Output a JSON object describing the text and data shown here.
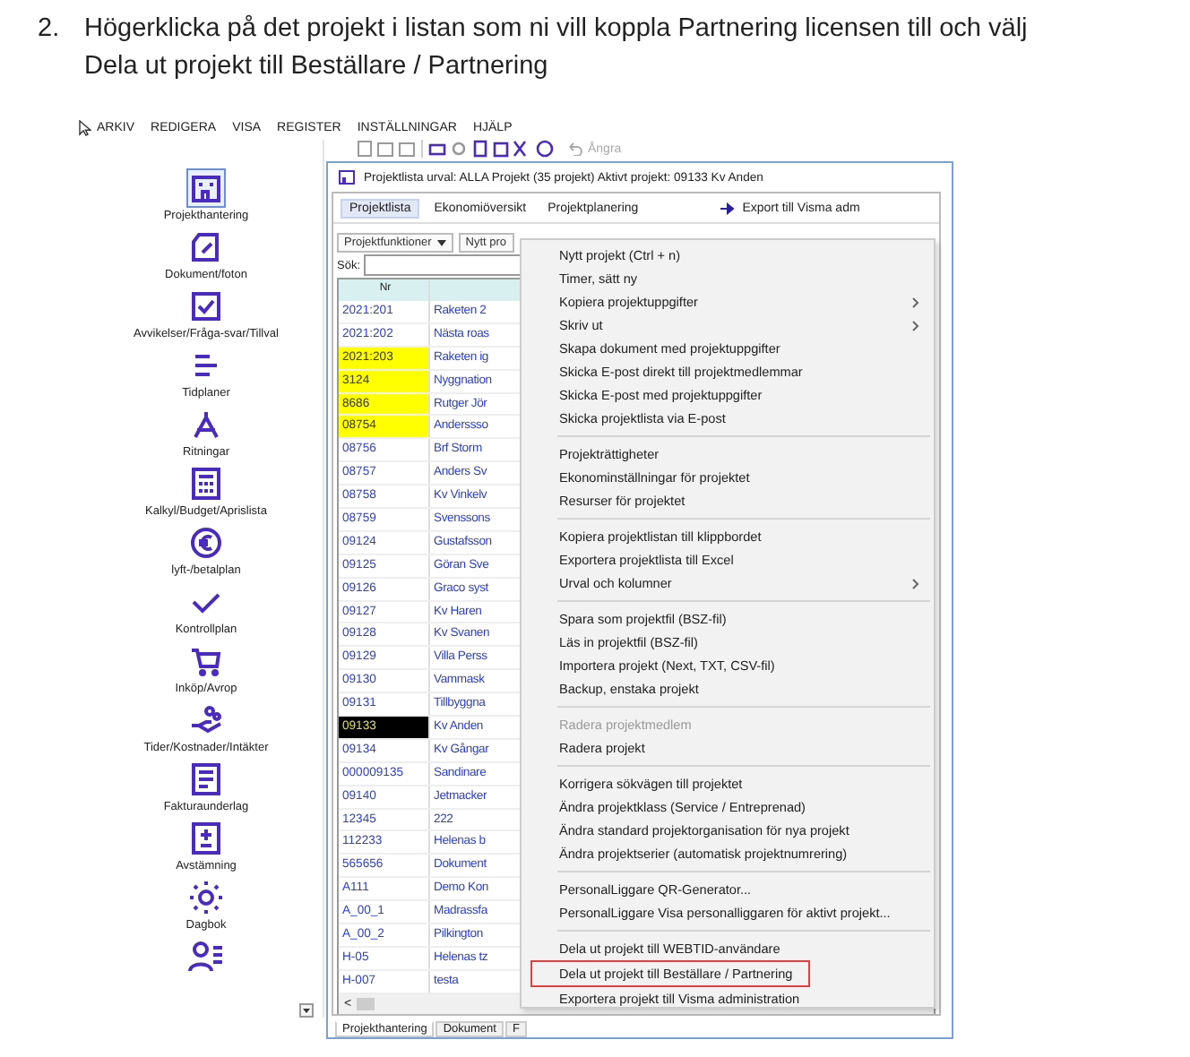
{
  "instruction": {
    "number": "2.",
    "lines": [
      "Högerklicka på det projekt i listan som ni vill koppla Partnering licensen till och välj",
      "Dela ut projekt till Beställare / Partnering"
    ]
  },
  "menubar": [
    "ARKIV",
    "REDIGERA",
    "VISA",
    "REGISTER",
    "INSTÄLLNINGAR",
    "HJÄLP"
  ],
  "toolbar": {
    "undo": "Ångra"
  },
  "sidebar": {
    "items": [
      {
        "label": "Projekthantering",
        "selected": true
      },
      {
        "label": "Dokument/foton",
        "selected": false
      },
      {
        "label": "Avvikelser/Fråga-svar/Tillval",
        "selected": false
      },
      {
        "label": "Tidplaner",
        "selected": false
      },
      {
        "label": "Ritningar",
        "selected": false
      },
      {
        "label": "Kalkyl/Budget/Aprislista",
        "selected": false
      },
      {
        "label": "lyft-/betalplan",
        "selected": false
      },
      {
        "label": "Kontrollplan",
        "selected": false
      },
      {
        "label": "Inköp/Avrop",
        "selected": false
      },
      {
        "label": "Tider/Kostnader/Intäkter",
        "selected": false
      },
      {
        "label": "Fakturaunderlag",
        "selected": false
      },
      {
        "label": "Avstämning",
        "selected": false
      },
      {
        "label": "Dagbok",
        "selected": false
      },
      {
        "selected": false
      }
    ]
  },
  "window": {
    "title": "Projektlista urval: ALLA Projekt (35 projekt) Aktivt projekt: 09133 Kv Anden",
    "tabs": [
      {
        "label": "Projektlista",
        "selected": true
      },
      {
        "label": "Ekonomiöversikt",
        "selected": false
      },
      {
        "label": "Projektplanering",
        "selected": false
      }
    ],
    "export": "Export till Visma adm",
    "functions": "Projektfunktioner",
    "new_project": "Nytt pro",
    "search_label": "Sök:",
    "table": {
      "columns": [
        "Nr"
      ],
      "rows": [
        {
          "nr": "2021:201",
          "name": "Raketen 2",
          "flagged": false,
          "selected": false
        },
        {
          "nr": "2021:202",
          "name": "Nästa roas",
          "flagged": false,
          "selected": false
        },
        {
          "nr": "2021:203",
          "name": "Raketen ig",
          "flagged": true,
          "selected": false
        },
        {
          "nr": "3124",
          "name": "Nyggnation",
          "flagged": true,
          "selected": false
        },
        {
          "nr": "8686",
          "name": "Rutger Jör",
          "flagged": true,
          "selected": false
        },
        {
          "nr": "08754",
          "name": "Anderssso",
          "flagged": true,
          "selected": false
        },
        {
          "nr": "08756",
          "name": "Brf Storm",
          "flagged": false,
          "selected": false
        },
        {
          "nr": "08757",
          "name": "Anders Sv",
          "flagged": false,
          "selected": false
        },
        {
          "nr": "08758",
          "name": "Kv Vinkelv",
          "flagged": false,
          "selected": false
        },
        {
          "nr": "08759",
          "name": "Svenssons",
          "flagged": false,
          "selected": false
        },
        {
          "nr": "09124",
          "name": "Gustafsson",
          "flagged": false,
          "selected": false
        },
        {
          "nr": "09125",
          "name": "Göran Sve",
          "flagged": false,
          "selected": false
        },
        {
          "nr": "09126",
          "name": "Graco syst",
          "flagged": false,
          "selected": false
        },
        {
          "nr": "09127",
          "name": "Kv Haren",
          "flagged": false,
          "selected": false
        },
        {
          "nr": "09128",
          "name": "Kv Svanen",
          "flagged": false,
          "selected": false
        },
        {
          "nr": "09129",
          "name": "Villa Perss",
          "flagged": false,
          "selected": false
        },
        {
          "nr": "09130",
          "name": "Vammask",
          "flagged": false,
          "selected": false
        },
        {
          "nr": "09131",
          "name": "Tillbyggna",
          "flagged": false,
          "selected": false
        },
        {
          "nr": "09133",
          "name": "Kv Anden",
          "flagged": false,
          "selected": true
        },
        {
          "nr": "09134",
          "name": "Kv Gångar",
          "flagged": false,
          "selected": false
        },
        {
          "nr": "000009135",
          "name": "Sandinare",
          "flagged": false,
          "selected": false
        },
        {
          "nr": "09140",
          "name": "Jetmacker",
          "flagged": false,
          "selected": false
        },
        {
          "nr": "12345",
          "name": "222",
          "flagged": false,
          "selected": false
        },
        {
          "nr": "112233",
          "name": "Helenas b",
          "flagged": false,
          "selected": false
        },
        {
          "nr": "565656",
          "name": "Dokument",
          "flagged": false,
          "selected": false
        },
        {
          "nr": "A111",
          "name": "Demo Kon",
          "flagged": false,
          "selected": false
        },
        {
          "nr": "A_00_1",
          "name": "Madrassfa",
          "flagged": false,
          "selected": false
        },
        {
          "nr": "A_00_2",
          "name": "Pilkington",
          "flagged": false,
          "selected": false
        },
        {
          "nr": "H-05",
          "name": "Helenas tz",
          "flagged": false,
          "selected": false
        },
        {
          "nr": "H-007",
          "name": "testa",
          "flagged": false,
          "selected": false
        }
      ]
    },
    "scroll_left": "<",
    "bottom_tabs": [
      {
        "label": "Projekthantering",
        "selected": true
      },
      {
        "label": "Dokument",
        "selected": false
      },
      {
        "label": "F",
        "selected": false
      }
    ]
  },
  "context_menu": {
    "groups": [
      [
        {
          "label": "Nytt projekt (Ctrl + n)",
          "submenu": false,
          "disabled": false,
          "highlighted": false
        },
        {
          "label": "Timer, sätt ny",
          "submenu": false,
          "disabled": false,
          "highlighted": false
        },
        {
          "label": "Kopiera projektuppgifter",
          "submenu": true,
          "disabled": false,
          "highlighted": false
        },
        {
          "label": "Skriv ut",
          "submenu": true,
          "disabled": false,
          "highlighted": false
        },
        {
          "label": "Skapa dokument med projektuppgifter",
          "submenu": false,
          "disabled": false,
          "highlighted": false
        },
        {
          "label": "Skicka E-post direkt till projektmedlemmar",
          "submenu": false,
          "disabled": false,
          "highlighted": false
        },
        {
          "label": "Skicka E-post med projektuppgifter",
          "submenu": false,
          "disabled": false,
          "highlighted": false
        },
        {
          "label": "Skicka projektlista via E-post",
          "submenu": false,
          "disabled": false,
          "highlighted": false
        }
      ],
      [
        {
          "label": "Projekträttigheter",
          "submenu": false,
          "disabled": false,
          "highlighted": false
        },
        {
          "label": "Ekonominställningar för projektet",
          "submenu": false,
          "disabled": false,
          "highlighted": false
        },
        {
          "label": "Resurser för projektet",
          "submenu": false,
          "disabled": false,
          "highlighted": false
        }
      ],
      [
        {
          "label": "Kopiera projektlistan till klippbordet",
          "submenu": false,
          "disabled": false,
          "highlighted": false
        },
        {
          "label": "Exportera projektlista till Excel",
          "submenu": false,
          "disabled": false,
          "highlighted": false
        },
        {
          "label": "Urval och kolumner",
          "submenu": true,
          "disabled": false,
          "highlighted": false
        }
      ],
      [
        {
          "label": "Spara som projektfil (BSZ-fil)",
          "submenu": false,
          "disabled": false,
          "highlighted": false
        },
        {
          "label": "Läs in projektfil (BSZ-fil)",
          "submenu": false,
          "disabled": false,
          "highlighted": false
        },
        {
          "label": "Importera projekt (Next, TXT, CSV-fil)",
          "submenu": false,
          "disabled": false,
          "highlighted": false
        },
        {
          "label": "Backup, enstaka projekt",
          "submenu": false,
          "disabled": false,
          "highlighted": false
        }
      ],
      [
        {
          "label": "Radera projektmedlem",
          "submenu": false,
          "disabled": true,
          "highlighted": false
        },
        {
          "label": "Radera projekt",
          "submenu": false,
          "disabled": false,
          "highlighted": false
        }
      ],
      [
        {
          "label": "Korrigera sökvägen till projektet",
          "submenu": false,
          "disabled": false,
          "highlighted": false
        },
        {
          "label": "Ändra projektklass (Service / Entreprenad)",
          "submenu": false,
          "disabled": false,
          "highlighted": false
        },
        {
          "label": "Ändra standard projektorganisation för nya projekt",
          "submenu": false,
          "disabled": false,
          "highlighted": false
        },
        {
          "label": "Ändra projektserier (automatisk projektnumrering)",
          "submenu": false,
          "disabled": false,
          "highlighted": false
        }
      ],
      [
        {
          "label": "PersonalLiggare QR-Generator...",
          "submenu": false,
          "disabled": false,
          "highlighted": false
        },
        {
          "label": "PersonalLiggare Visa personalliggaren för aktivt projekt...",
          "submenu": false,
          "disabled": false,
          "highlighted": false
        }
      ],
      [
        {
          "label": "Dela ut projekt till WEBTID-användare",
          "submenu": false,
          "disabled": false,
          "highlighted": false
        },
        {
          "label": "Dela ut projekt till Beställare / Partnering",
          "submenu": false,
          "disabled": false,
          "highlighted": true
        },
        {
          "label": "Exportera projekt till Visma administration",
          "submenu": false,
          "disabled": false,
          "highlighted": false
        }
      ]
    ]
  }
}
